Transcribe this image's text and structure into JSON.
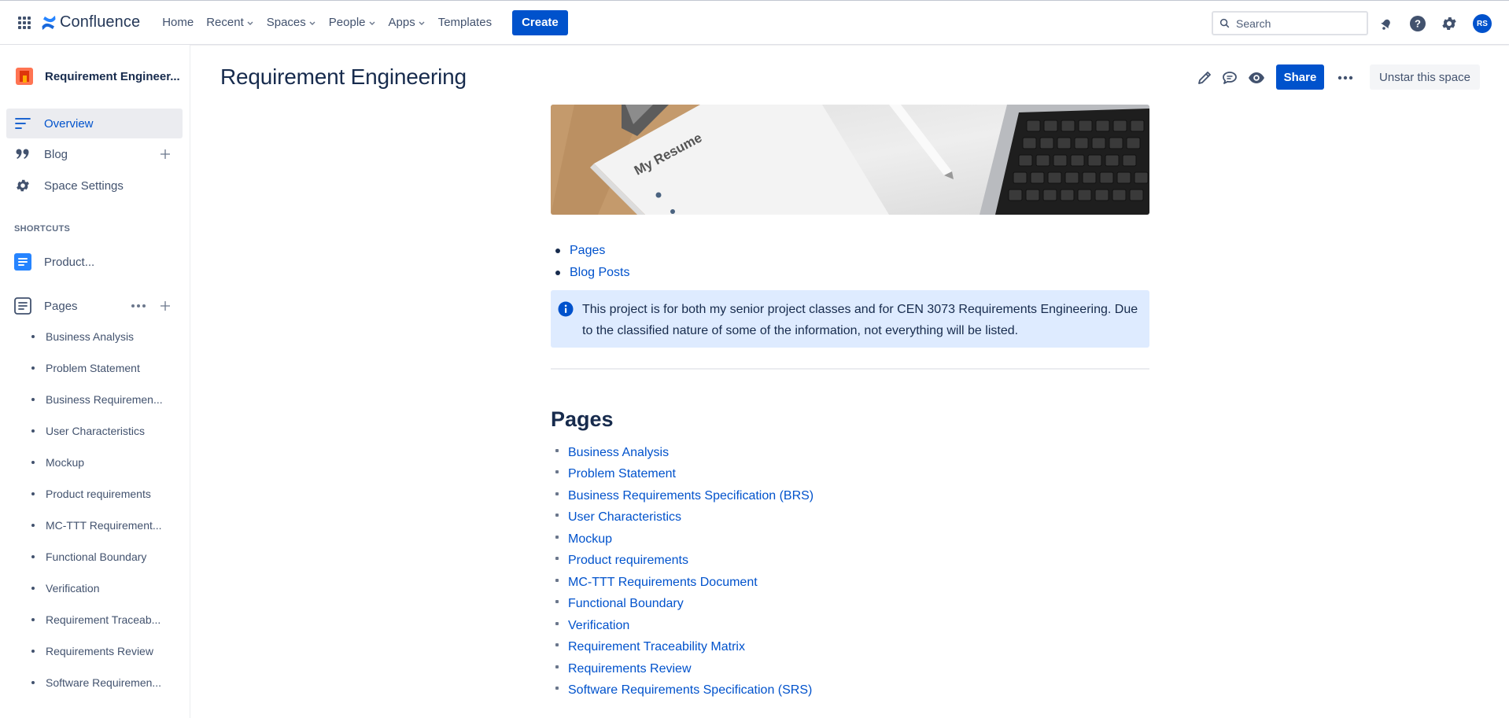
{
  "topnav": {
    "logo_text": "Confluence",
    "items": [
      {
        "label": "Home",
        "has_dropdown": false
      },
      {
        "label": "Recent",
        "has_dropdown": true
      },
      {
        "label": "Spaces",
        "has_dropdown": true
      },
      {
        "label": "People",
        "has_dropdown": true
      },
      {
        "label": "Apps",
        "has_dropdown": true
      },
      {
        "label": "Templates",
        "has_dropdown": false
      }
    ],
    "create_label": "Create",
    "search_placeholder": "Search",
    "avatar_initials": "RS",
    "icons": [
      "app-switcher-icon",
      "notifications-icon",
      "help-icon",
      "settings-icon"
    ]
  },
  "sidebar": {
    "space_name": "Requirement Engineer...",
    "items": [
      {
        "label": "Overview",
        "icon": "overview-icon",
        "active": true
      },
      {
        "label": "Blog",
        "icon": "quote-icon",
        "active": false
      },
      {
        "label": "Space Settings",
        "icon": "gear-icon",
        "active": false
      }
    ],
    "shortcuts_title": "SHORTCUTS",
    "shortcut_label": "Product...",
    "pages_label": "Pages",
    "pages": [
      "Business Analysis",
      "Problem Statement",
      "Business Requiremen...",
      "User Characteristics",
      "Mockup",
      "Product requirements",
      "MC-TTT Requirement...",
      "Functional Boundary",
      "Verification",
      "Requirement Traceab...",
      "Requirements Review",
      "Software Requiremen..."
    ]
  },
  "main": {
    "title": "Requirement Engineering",
    "share_label": "Share",
    "unstar_label": "Unstar this space",
    "banner_text": "My Resume",
    "toc": [
      "Pages",
      "Blog Posts"
    ],
    "info_text": "This project is for both my senior project classes and for CEN 3073 Requirements Engineering. Due to the classified nature of some of the information, not everything will be listed.",
    "pages_heading": "Pages",
    "child_pages": [
      "Business Analysis",
      "Problem Statement",
      "Business Requirements Specification (BRS)",
      "User Characteristics",
      "Mockup",
      "Product requirements",
      "MC-TTT Requirements Document",
      "Functional Boundary",
      "Verification",
      "Requirement Traceability Matrix",
      "Requirements Review",
      "Software Requirements Specification (SRS)"
    ]
  },
  "colors": {
    "primary": "#0052cc",
    "link": "#0052cc",
    "text": "#172b4d",
    "info_bg": "#deebff",
    "active_bg": "#ebecf0"
  }
}
